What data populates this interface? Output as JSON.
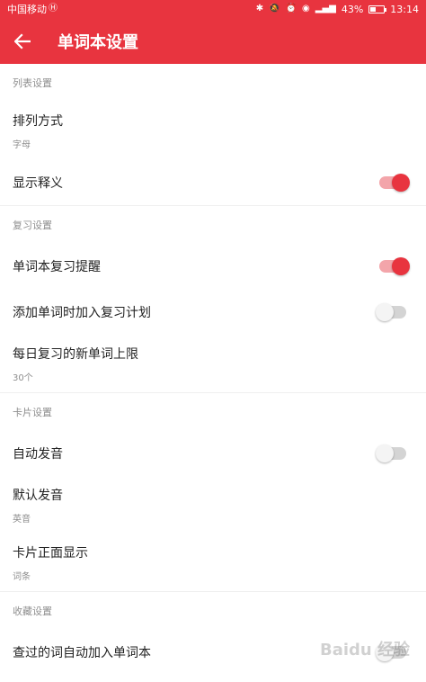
{
  "status_bar": {
    "carrier": "中国移动",
    "battery": "43%",
    "battery_level": 0.43,
    "time": "13:14"
  },
  "header": {
    "title": "单词本设置"
  },
  "sections": {
    "list": {
      "title": "列表设置",
      "sort_label": "排列方式",
      "sort_value": "字母",
      "show_definition_label": "显示释义",
      "show_definition_on": true
    },
    "review": {
      "title": "复习设置",
      "reminder_label": "单词本复习提醒",
      "reminder_on": true,
      "add_to_plan_label": "添加单词时加入复习计划",
      "add_to_plan_on": false,
      "daily_limit_label": "每日复习的新单词上限",
      "daily_limit_value": "30个"
    },
    "card": {
      "title": "卡片设置",
      "auto_pronounce_label": "自动发音",
      "auto_pronounce_on": false,
      "default_pronounce_label": "默认发音",
      "default_pronounce_value": "英音",
      "card_front_label": "卡片正面显示",
      "card_front_value": "词条"
    },
    "favorites": {
      "title": "收藏设置",
      "auto_add_label": "查过的词自动加入单词本",
      "auto_add_on": false
    }
  },
  "watermark": "Baidu 经验",
  "colors": {
    "accent": "#e8343f",
    "toggle_track_on": "#f3a5aa",
    "toggle_track_off": "#d4d4d4"
  }
}
